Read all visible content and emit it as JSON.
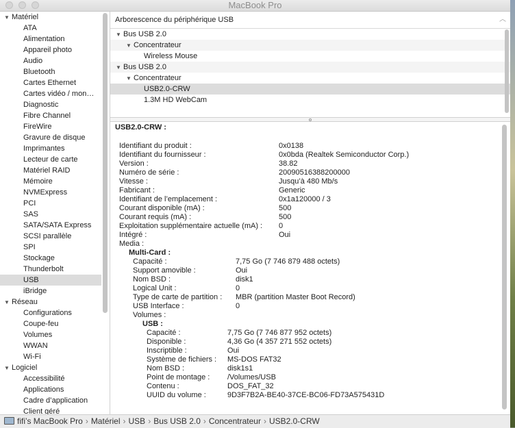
{
  "window": {
    "title": "MacBook Pro"
  },
  "sidebar": {
    "groups": [
      {
        "label": "Matériel",
        "items": [
          "ATA",
          "Alimentation",
          "Appareil photo",
          "Audio",
          "Bluetooth",
          "Cartes Ethernet",
          "Cartes vidéo / mon…",
          "Diagnostic",
          "Fibre Channel",
          "FireWire",
          "Gravure de disque",
          "Imprimantes",
          "Lecteur de carte",
          "Matériel RAID",
          "Mémoire",
          "NVMExpress",
          "PCI",
          "SAS",
          "SATA/SATA Express",
          "SCSI parallèle",
          "SPI",
          "Stockage",
          "Thunderbolt",
          "USB",
          "iBridge"
        ]
      },
      {
        "label": "Réseau",
        "items": [
          "Configurations",
          "Coupe-feu",
          "Volumes",
          "WWAN",
          "Wi-Fi"
        ]
      },
      {
        "label": "Logiciel",
        "items": [
          "Accessibilité",
          "Applications",
          "Cadre d’application",
          "Client géré"
        ]
      }
    ],
    "selected": "USB"
  },
  "tree": {
    "header": "Arborescence du périphérique USB",
    "rows": [
      {
        "label": "Bus USB 2.0",
        "level": 0,
        "expanded": true
      },
      {
        "label": "Concentrateur",
        "level": 1,
        "expanded": true
      },
      {
        "label": "Wireless Mouse",
        "level": 2
      },
      {
        "label": "Bus USB 2.0",
        "level": 0,
        "expanded": true
      },
      {
        "label": "Concentrateur",
        "level": 1,
        "expanded": true
      },
      {
        "label": "USB2.0-CRW",
        "level": 2,
        "selected": true
      },
      {
        "label": "1.3M HD WebCam",
        "level": 2
      }
    ]
  },
  "details": {
    "title": "USB2.0-CRW :",
    "main": [
      [
        "Identifiant du produit :",
        "0x0138"
      ],
      [
        "Identifiant du fournisseur :",
        "0x0bda  (Realtek Semiconductor Corp.)"
      ],
      [
        "Version :",
        "38.82"
      ],
      [
        "Numéro de série :",
        "20090516388200000"
      ],
      [
        "Vitesse :",
        "Jusqu’à 480 Mb/s"
      ],
      [
        "Fabricant :",
        "Generic"
      ],
      [
        "Identifiant de l’emplacement :",
        "0x1a120000 / 3"
      ],
      [
        "Courant disponible (mA) :",
        "500"
      ],
      [
        "Courant requis (mA) :",
        "500"
      ],
      [
        "Exploitation supplémentaire actuelle (mA) :",
        "0"
      ],
      [
        "Intégré :",
        "Oui"
      ],
      [
        "Media :",
        ""
      ]
    ],
    "media_name": "Multi-Card :",
    "media": [
      [
        "Capacité :",
        "7,75 Go (7 746 879 488 octets)"
      ],
      [
        "Support amovible :",
        "Oui"
      ],
      [
        "Nom BSD :",
        "disk1"
      ],
      [
        "Logical Unit :",
        "0"
      ],
      [
        "Type de carte de partition :",
        "MBR (partition Master Boot Record)"
      ],
      [
        "USB Interface :",
        "0"
      ],
      [
        "Volumes :",
        ""
      ]
    ],
    "volume_name": "USB :",
    "volume": [
      [
        "Capacité :",
        "7,75 Go (7 746 877 952 octets)"
      ],
      [
        "Disponible :",
        "4,36 Go (4 357 271 552 octets)"
      ],
      [
        "Inscriptible :",
        "Oui"
      ],
      [
        "Système de fichiers :",
        "MS-DOS FAT32"
      ],
      [
        "Nom BSD :",
        "disk1s1"
      ],
      [
        "Point de montage :",
        "/Volumes/USB"
      ],
      [
        "Contenu :",
        "DOS_FAT_32"
      ],
      [
        "UUID du volume :",
        "9D3F7B2A-BE40-37CE-BC06-FD73A575431D"
      ]
    ]
  },
  "pathbar": {
    "items": [
      "fifi’s MacBook Pro",
      "Matériel",
      "USB",
      "Bus USB 2.0",
      "Concentrateur",
      "USB2.0-CRW"
    ],
    "separator": "›"
  }
}
